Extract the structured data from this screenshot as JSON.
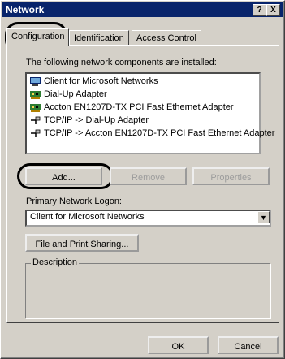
{
  "window": {
    "title": "Network",
    "help_label": "?",
    "close_label": "X"
  },
  "tabs": [
    {
      "label": "Configuration",
      "active": true
    },
    {
      "label": "Identification",
      "active": false
    },
    {
      "label": "Access Control",
      "active": false
    }
  ],
  "components": {
    "caption": "The following network components are installed:",
    "items": [
      {
        "label": "Client for Microsoft Networks",
        "icon": "client-icon"
      },
      {
        "label": "Dial-Up Adapter",
        "icon": "adapter-icon"
      },
      {
        "label": "Accton EN1207D-TX PCI Fast Ethernet Adapter",
        "icon": "adapter-icon"
      },
      {
        "label": "TCP/IP -> Dial-Up Adapter",
        "icon": "protocol-icon"
      },
      {
        "label": "TCP/IP -> Accton EN1207D-TX PCI Fast Ethernet Adapter",
        "icon": "protocol-icon"
      }
    ]
  },
  "buttons": {
    "add": "Add...",
    "remove": "Remove",
    "properties": "Properties",
    "sharing": "File and Print Sharing...",
    "ok": "OK",
    "cancel": "Cancel"
  },
  "logon": {
    "label": "Primary Network Logon:",
    "value": "Client for Microsoft Networks"
  },
  "description": {
    "label": "Description"
  },
  "colors": {
    "titlebar": "#08246b",
    "face": "#d4d0c8"
  }
}
